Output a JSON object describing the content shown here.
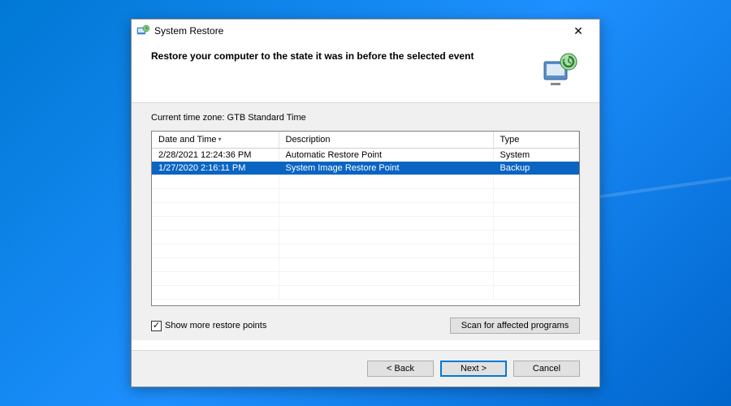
{
  "window": {
    "title": "System Restore",
    "close_glyph": "✕"
  },
  "header": {
    "heading": "Restore your computer to the state it was in before the selected event"
  },
  "timezone_label": "Current time zone: GTB Standard Time",
  "columns": {
    "date": "Date and Time",
    "description": "Description",
    "type": "Type",
    "sort_indicator": "▾"
  },
  "rows": [
    {
      "date": "2/28/2021 12:24:36 PM",
      "description": "Automatic Restore Point",
      "type": "System",
      "selected": false
    },
    {
      "date": "1/27/2020 2:16:11 PM",
      "description": "System Image Restore Point",
      "type": "Backup",
      "selected": true
    }
  ],
  "checkbox": {
    "checked_glyph": "✓",
    "label": "Show more restore points",
    "checked": true
  },
  "buttons": {
    "scan": "Scan for affected programs",
    "back": "< Back",
    "next": "Next >",
    "cancel": "Cancel"
  }
}
